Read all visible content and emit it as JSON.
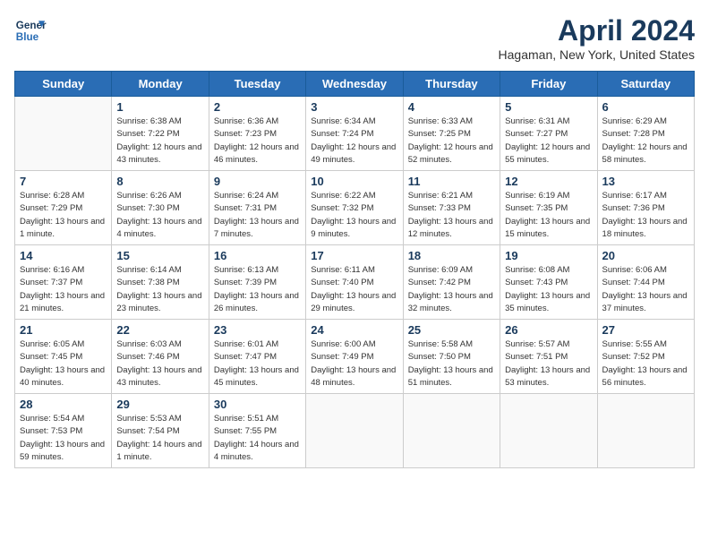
{
  "header": {
    "logo_line1": "General",
    "logo_line2": "Blue",
    "month_year": "April 2024",
    "location": "Hagaman, New York, United States"
  },
  "days_of_week": [
    "Sunday",
    "Monday",
    "Tuesday",
    "Wednesday",
    "Thursday",
    "Friday",
    "Saturday"
  ],
  "weeks": [
    [
      {
        "day": "",
        "sunrise": "",
        "sunset": "",
        "daylight": ""
      },
      {
        "day": "1",
        "sunrise": "Sunrise: 6:38 AM",
        "sunset": "Sunset: 7:22 PM",
        "daylight": "Daylight: 12 hours and 43 minutes."
      },
      {
        "day": "2",
        "sunrise": "Sunrise: 6:36 AM",
        "sunset": "Sunset: 7:23 PM",
        "daylight": "Daylight: 12 hours and 46 minutes."
      },
      {
        "day": "3",
        "sunrise": "Sunrise: 6:34 AM",
        "sunset": "Sunset: 7:24 PM",
        "daylight": "Daylight: 12 hours and 49 minutes."
      },
      {
        "day": "4",
        "sunrise": "Sunrise: 6:33 AM",
        "sunset": "Sunset: 7:25 PM",
        "daylight": "Daylight: 12 hours and 52 minutes."
      },
      {
        "day": "5",
        "sunrise": "Sunrise: 6:31 AM",
        "sunset": "Sunset: 7:27 PM",
        "daylight": "Daylight: 12 hours and 55 minutes."
      },
      {
        "day": "6",
        "sunrise": "Sunrise: 6:29 AM",
        "sunset": "Sunset: 7:28 PM",
        "daylight": "Daylight: 12 hours and 58 minutes."
      }
    ],
    [
      {
        "day": "7",
        "sunrise": "Sunrise: 6:28 AM",
        "sunset": "Sunset: 7:29 PM",
        "daylight": "Daylight: 13 hours and 1 minute."
      },
      {
        "day": "8",
        "sunrise": "Sunrise: 6:26 AM",
        "sunset": "Sunset: 7:30 PM",
        "daylight": "Daylight: 13 hours and 4 minutes."
      },
      {
        "day": "9",
        "sunrise": "Sunrise: 6:24 AM",
        "sunset": "Sunset: 7:31 PM",
        "daylight": "Daylight: 13 hours and 7 minutes."
      },
      {
        "day": "10",
        "sunrise": "Sunrise: 6:22 AM",
        "sunset": "Sunset: 7:32 PM",
        "daylight": "Daylight: 13 hours and 9 minutes."
      },
      {
        "day": "11",
        "sunrise": "Sunrise: 6:21 AM",
        "sunset": "Sunset: 7:33 PM",
        "daylight": "Daylight: 13 hours and 12 minutes."
      },
      {
        "day": "12",
        "sunrise": "Sunrise: 6:19 AM",
        "sunset": "Sunset: 7:35 PM",
        "daylight": "Daylight: 13 hours and 15 minutes."
      },
      {
        "day": "13",
        "sunrise": "Sunrise: 6:17 AM",
        "sunset": "Sunset: 7:36 PM",
        "daylight": "Daylight: 13 hours and 18 minutes."
      }
    ],
    [
      {
        "day": "14",
        "sunrise": "Sunrise: 6:16 AM",
        "sunset": "Sunset: 7:37 PM",
        "daylight": "Daylight: 13 hours and 21 minutes."
      },
      {
        "day": "15",
        "sunrise": "Sunrise: 6:14 AM",
        "sunset": "Sunset: 7:38 PM",
        "daylight": "Daylight: 13 hours and 23 minutes."
      },
      {
        "day": "16",
        "sunrise": "Sunrise: 6:13 AM",
        "sunset": "Sunset: 7:39 PM",
        "daylight": "Daylight: 13 hours and 26 minutes."
      },
      {
        "day": "17",
        "sunrise": "Sunrise: 6:11 AM",
        "sunset": "Sunset: 7:40 PM",
        "daylight": "Daylight: 13 hours and 29 minutes."
      },
      {
        "day": "18",
        "sunrise": "Sunrise: 6:09 AM",
        "sunset": "Sunset: 7:42 PM",
        "daylight": "Daylight: 13 hours and 32 minutes."
      },
      {
        "day": "19",
        "sunrise": "Sunrise: 6:08 AM",
        "sunset": "Sunset: 7:43 PM",
        "daylight": "Daylight: 13 hours and 35 minutes."
      },
      {
        "day": "20",
        "sunrise": "Sunrise: 6:06 AM",
        "sunset": "Sunset: 7:44 PM",
        "daylight": "Daylight: 13 hours and 37 minutes."
      }
    ],
    [
      {
        "day": "21",
        "sunrise": "Sunrise: 6:05 AM",
        "sunset": "Sunset: 7:45 PM",
        "daylight": "Daylight: 13 hours and 40 minutes."
      },
      {
        "day": "22",
        "sunrise": "Sunrise: 6:03 AM",
        "sunset": "Sunset: 7:46 PM",
        "daylight": "Daylight: 13 hours and 43 minutes."
      },
      {
        "day": "23",
        "sunrise": "Sunrise: 6:01 AM",
        "sunset": "Sunset: 7:47 PM",
        "daylight": "Daylight: 13 hours and 45 minutes."
      },
      {
        "day": "24",
        "sunrise": "Sunrise: 6:00 AM",
        "sunset": "Sunset: 7:49 PM",
        "daylight": "Daylight: 13 hours and 48 minutes."
      },
      {
        "day": "25",
        "sunrise": "Sunrise: 5:58 AM",
        "sunset": "Sunset: 7:50 PM",
        "daylight": "Daylight: 13 hours and 51 minutes."
      },
      {
        "day": "26",
        "sunrise": "Sunrise: 5:57 AM",
        "sunset": "Sunset: 7:51 PM",
        "daylight": "Daylight: 13 hours and 53 minutes."
      },
      {
        "day": "27",
        "sunrise": "Sunrise: 5:55 AM",
        "sunset": "Sunset: 7:52 PM",
        "daylight": "Daylight: 13 hours and 56 minutes."
      }
    ],
    [
      {
        "day": "28",
        "sunrise": "Sunrise: 5:54 AM",
        "sunset": "Sunset: 7:53 PM",
        "daylight": "Daylight: 13 hours and 59 minutes."
      },
      {
        "day": "29",
        "sunrise": "Sunrise: 5:53 AM",
        "sunset": "Sunset: 7:54 PM",
        "daylight": "Daylight: 14 hours and 1 minute."
      },
      {
        "day": "30",
        "sunrise": "Sunrise: 5:51 AM",
        "sunset": "Sunset: 7:55 PM",
        "daylight": "Daylight: 14 hours and 4 minutes."
      },
      {
        "day": "",
        "sunrise": "",
        "sunset": "",
        "daylight": ""
      },
      {
        "day": "",
        "sunrise": "",
        "sunset": "",
        "daylight": ""
      },
      {
        "day": "",
        "sunrise": "",
        "sunset": "",
        "daylight": ""
      },
      {
        "day": "",
        "sunrise": "",
        "sunset": "",
        "daylight": ""
      }
    ]
  ]
}
